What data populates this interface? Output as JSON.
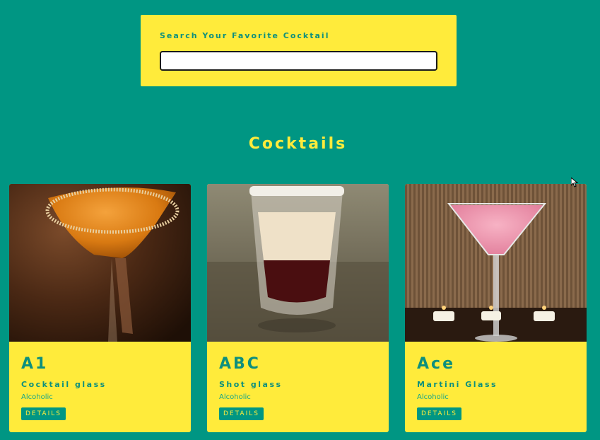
{
  "search": {
    "label": "Search Your Favorite Cocktail",
    "value": "",
    "placeholder": ""
  },
  "section_title": "Cocktails",
  "cards": [
    {
      "name": "A1",
      "glass": "Cocktail glass",
      "type": "Alcoholic",
      "details_label": "DETAILS",
      "image": "orange-cocktail-in-sugar-rimmed-martini-glass"
    },
    {
      "name": "ABC",
      "glass": "Shot glass",
      "type": "Alcoholic",
      "details_label": "DETAILS",
      "image": "layered-shot-in-salt-rimmed-glass"
    },
    {
      "name": "Ace",
      "glass": "Martini Glass",
      "type": "Alcoholic",
      "details_label": "DETAILS",
      "image": "pink-cocktail-in-martini-glass-with-candles"
    }
  ],
  "colors": {
    "background": "#009683",
    "accent": "#ffeb3b",
    "text": "#0d8f7d"
  },
  "icons": {
    "cursor": "mouse-pointer-icon"
  }
}
